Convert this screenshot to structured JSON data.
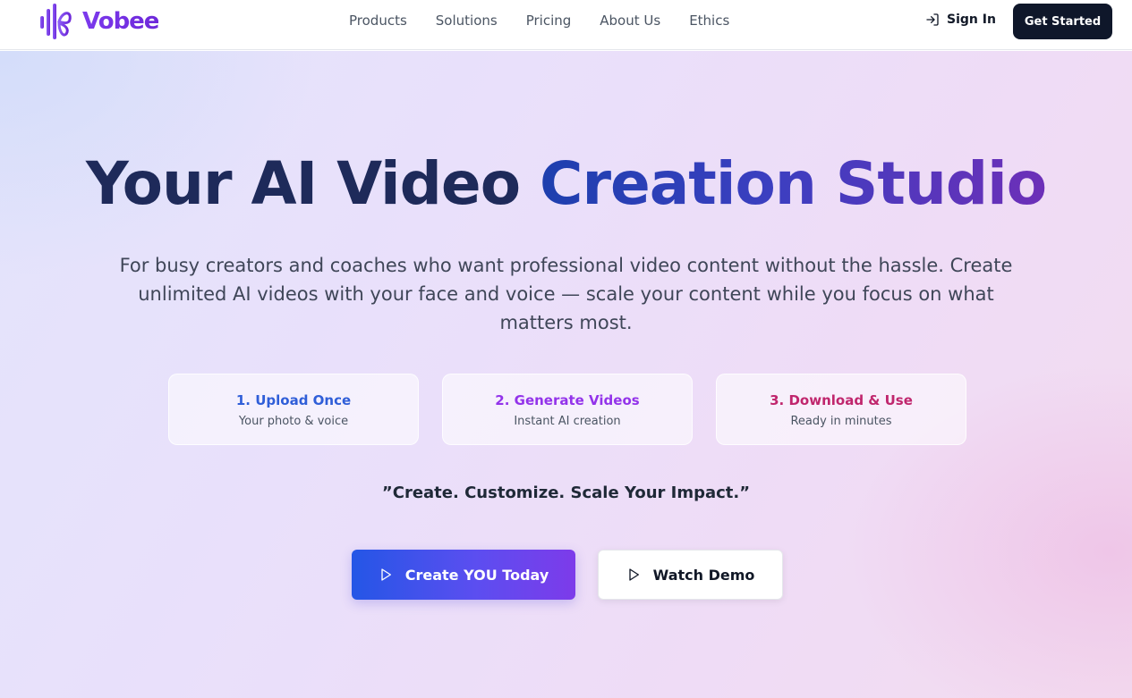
{
  "brand": {
    "name": "Vobee",
    "logo_icon": "waveform-butterfly-icon",
    "color_primary": "#7c3aed"
  },
  "nav": {
    "items": [
      {
        "label": "Products"
      },
      {
        "label": "Solutions"
      },
      {
        "label": "Pricing"
      },
      {
        "label": "About Us"
      },
      {
        "label": "Ethics"
      }
    ],
    "signin_label": "Sign In",
    "signin_icon": "sign-in-icon",
    "get_started_label": "Get Started"
  },
  "hero": {
    "title_part1": "Your AI Video ",
    "title_part2": "Creation Studio",
    "subtitle": "For busy creators and coaches who want professional video content without the hassle. Create unlimited AI videos with your face and voice — scale your content while you focus on what matters most.",
    "steps": [
      {
        "title": "1. Upload Once",
        "desc": "Your photo & voice",
        "color": "#2f5ed8"
      },
      {
        "title": "2. Generate Videos",
        "desc": "Instant AI creation",
        "color": "#9333ea"
      },
      {
        "title": "3. Download & Use",
        "desc": "Ready in minutes",
        "color": "#c0266d"
      }
    ],
    "tagline": "”Create. Customize. Scale Your Impact.”",
    "cta_primary_label": "Create YOU Today",
    "cta_secondary_label": "Watch Demo",
    "cta_icon": "play-icon"
  }
}
